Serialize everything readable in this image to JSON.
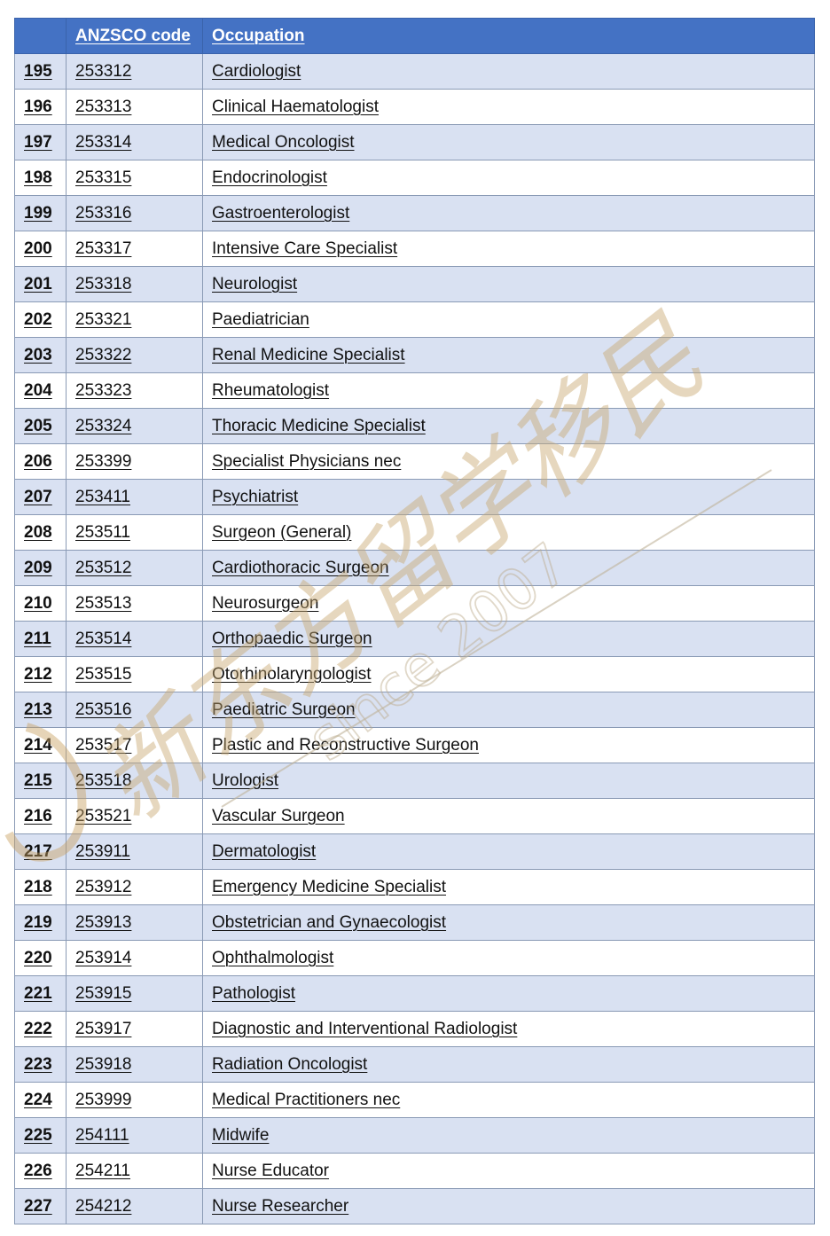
{
  "table": {
    "headers": [
      "",
      "ANZSCO code",
      "Occupation"
    ],
    "rows": [
      {
        "num": "195",
        "code": "253312",
        "occupation": "Cardiologist"
      },
      {
        "num": "196",
        "code": "253313",
        "occupation": "Clinical Haematologist"
      },
      {
        "num": "197",
        "code": "253314",
        "occupation": "Medical Oncologist"
      },
      {
        "num": "198",
        "code": "253315",
        "occupation": "Endocrinologist"
      },
      {
        "num": "199",
        "code": "253316",
        "occupation": "Gastroenterologist"
      },
      {
        "num": "200",
        "code": "253317",
        "occupation": "Intensive Care Specialist"
      },
      {
        "num": "201",
        "code": "253318",
        "occupation": "Neurologist"
      },
      {
        "num": "202",
        "code": "253321",
        "occupation": "Paediatrician"
      },
      {
        "num": "203",
        "code": "253322",
        "occupation": "Renal Medicine Specialist"
      },
      {
        "num": "204",
        "code": "253323",
        "occupation": "Rheumatologist"
      },
      {
        "num": "205",
        "code": "253324",
        "occupation": "Thoracic Medicine Specialist"
      },
      {
        "num": "206",
        "code": "253399",
        "occupation": "Specialist Physicians nec"
      },
      {
        "num": "207",
        "code": "253411",
        "occupation": "Psychiatrist"
      },
      {
        "num": "208",
        "code": "253511",
        "occupation": "Surgeon (General)"
      },
      {
        "num": "209",
        "code": "253512",
        "occupation": "Cardiothoracic Surgeon"
      },
      {
        "num": "210",
        "code": "253513",
        "occupation": "Neurosurgeon"
      },
      {
        "num": "211",
        "code": "253514",
        "occupation": "Orthopaedic Surgeon"
      },
      {
        "num": "212",
        "code": "253515",
        "occupation": "Otorhinolaryngologist"
      },
      {
        "num": "213",
        "code": "253516",
        "occupation": "Paediatric Surgeon"
      },
      {
        "num": "214",
        "code": "253517",
        "occupation": "Plastic and Reconstructive Surgeon"
      },
      {
        "num": "215",
        "code": "253518",
        "occupation": "Urologist"
      },
      {
        "num": "216",
        "code": "253521",
        "occupation": "Vascular Surgeon"
      },
      {
        "num": "217",
        "code": "253911",
        "occupation": "Dermatologist"
      },
      {
        "num": "218",
        "code": "253912",
        "occupation": "Emergency Medicine Specialist"
      },
      {
        "num": "219",
        "code": "253913",
        "occupation": "Obstetrician and Gynaecologist"
      },
      {
        "num": "220",
        "code": "253914",
        "occupation": "Ophthalmologist"
      },
      {
        "num": "221",
        "code": "253915",
        "occupation": "Pathologist"
      },
      {
        "num": "222",
        "code": "253917",
        "occupation": "Diagnostic and Interventional Radiologist"
      },
      {
        "num": "223",
        "code": "253918",
        "occupation": "Radiation Oncologist"
      },
      {
        "num": "224",
        "code": "253999",
        "occupation": "Medical Practitioners nec"
      },
      {
        "num": "225",
        "code": "254111",
        "occupation": "Midwife"
      },
      {
        "num": "226",
        "code": "254211",
        "occupation": "Nurse Educator"
      },
      {
        "num": "227",
        "code": "254212",
        "occupation": "Nurse Researcher"
      }
    ]
  },
  "watermark": {
    "chinese_text": "新东方留学移民",
    "since_text": "since 2007",
    "color": "#c8a870"
  },
  "colors": {
    "header_bg": "#4472c4",
    "band_bg": "#d9e1f2",
    "border": "#8a9ab5"
  }
}
